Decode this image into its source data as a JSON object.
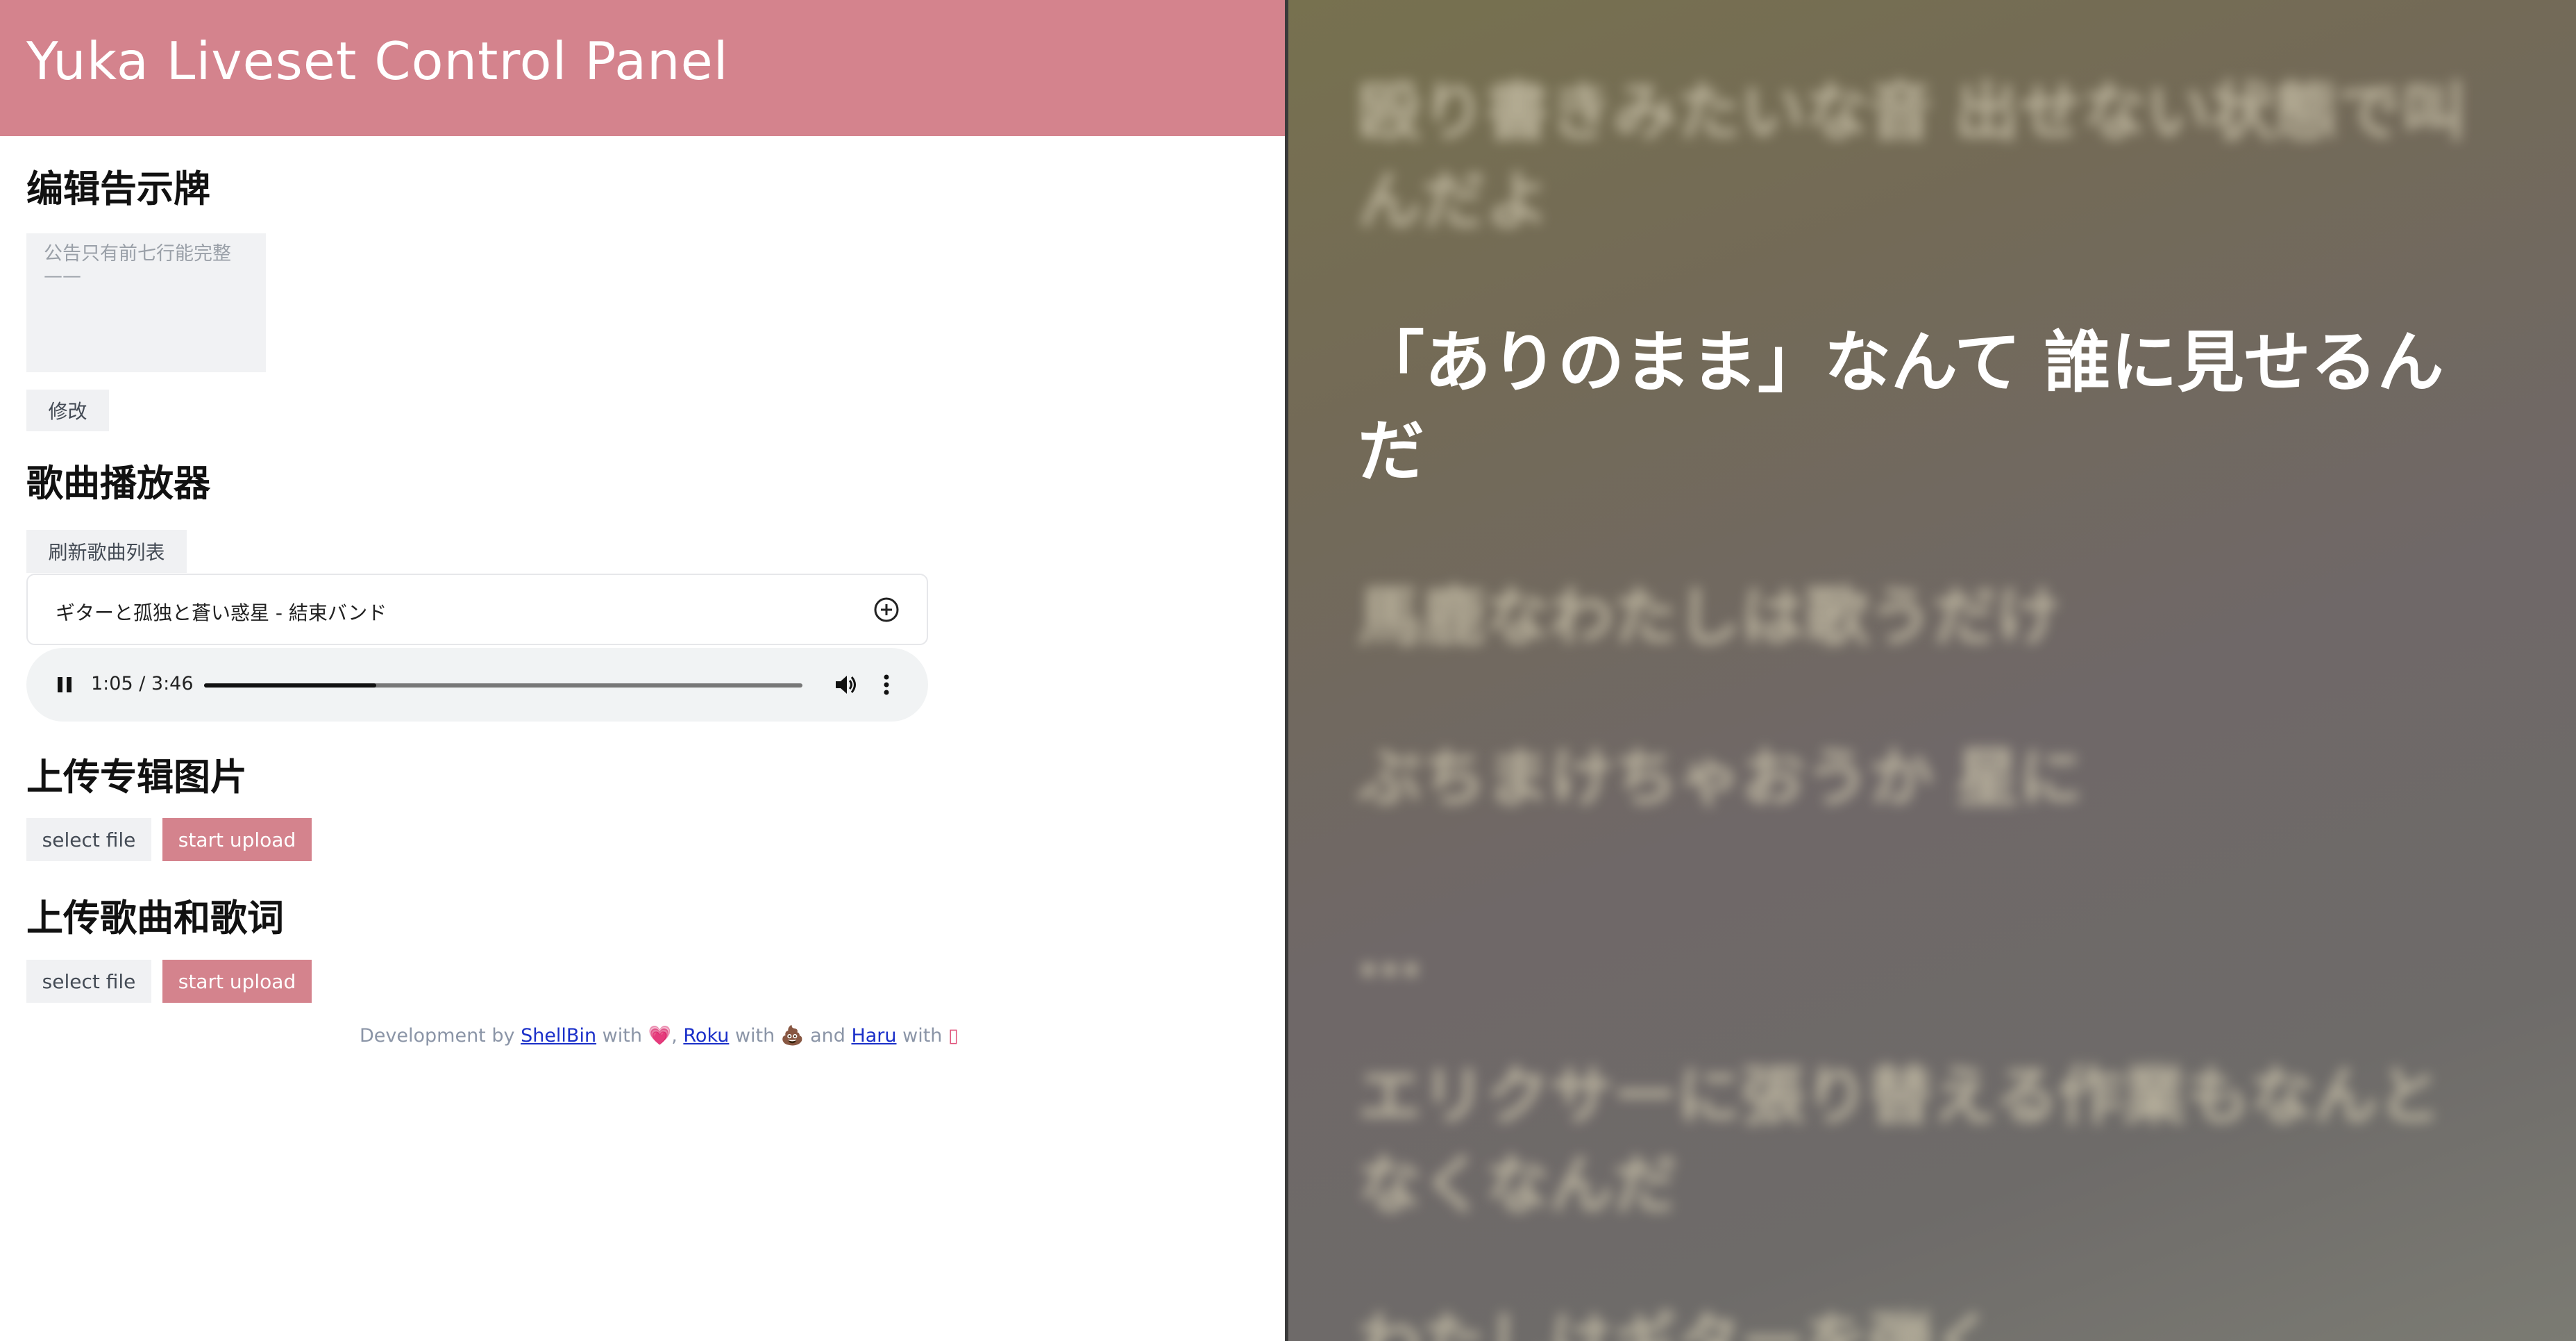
{
  "app": {
    "title": "Yuka Liveset Control Panel",
    "accent_color": "#d4838d"
  },
  "bulletin": {
    "heading": "编辑告示牌",
    "placeholder": "公告只有前七行能完整\n——",
    "submit_label": "修改"
  },
  "player": {
    "heading": "歌曲播放器",
    "refresh_label": "刷新歌曲列表",
    "selected_song": "ギターと孤独と蒼い惑星 - 結束バンド",
    "select_icon": "plus-circle-icon",
    "time_text": "1:05 / 3:46",
    "progress": 0.288,
    "state": "playing"
  },
  "upload_album": {
    "heading": "上传专辑图片",
    "select_label": "select file",
    "upload_label": "start upload"
  },
  "upload_song": {
    "heading": "上传歌曲和歌词",
    "select_label": "select file",
    "upload_label": "start upload"
  },
  "footer": {
    "prefix": "Development by",
    "dev1": "ShellBin",
    "with1": "with",
    "emoji1": "💗",
    "sep": ",",
    "dev2": "Roku",
    "with2": "with",
    "emoji2": "💩",
    "and": "and",
    "dev3": "Haru",
    "with3": "with",
    "emoji3": "▯"
  },
  "lyrics": {
    "lines": [
      "殴り書きみたいな音 出せない状態で叫んだよ",
      "「ありのまま」なんて 誰に見せるんだ",
      "馬鹿なわたしは歌うだけ",
      "ぶちまけちゃおうか 星に",
      "…",
      "エリクサーに張り替える作業もなんとなくなんだ",
      "わたしはギターを弾く"
    ],
    "active_index": 1
  }
}
